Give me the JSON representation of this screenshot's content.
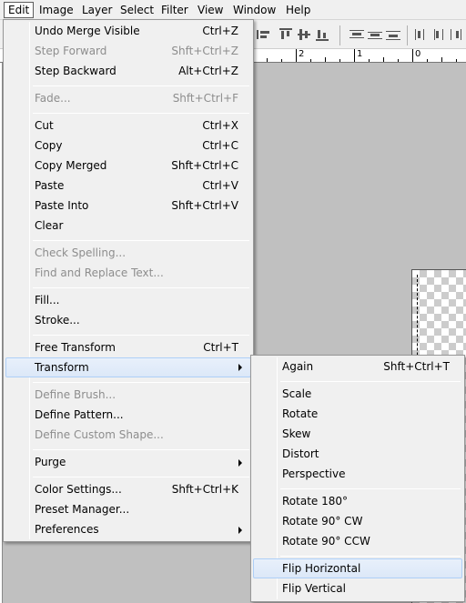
{
  "menubar": {
    "items": [
      "Edit",
      "Image",
      "Layer",
      "Select",
      "Filter",
      "View",
      "Window",
      "Help"
    ],
    "active": "Edit"
  },
  "ruler": {
    "labels": [
      "2",
      "1",
      "0"
    ]
  },
  "edit_menu": {
    "items": [
      {
        "label": "Undo Merge Visible",
        "shortcut": "Ctrl+Z",
        "enabled": true
      },
      {
        "label": "Step Forward",
        "shortcut": "Shft+Ctrl+Z",
        "enabled": false
      },
      {
        "label": "Step Backward",
        "shortcut": "Alt+Ctrl+Z",
        "enabled": true
      },
      {
        "label": "Fade...",
        "shortcut": "Shft+Ctrl+F",
        "enabled": false
      },
      {
        "label": "Cut",
        "shortcut": "Ctrl+X",
        "enabled": true
      },
      {
        "label": "Copy",
        "shortcut": "Ctrl+C",
        "enabled": true
      },
      {
        "label": "Copy Merged",
        "shortcut": "Shft+Ctrl+C",
        "enabled": true
      },
      {
        "label": "Paste",
        "shortcut": "Ctrl+V",
        "enabled": true
      },
      {
        "label": "Paste Into",
        "shortcut": "Shft+Ctrl+V",
        "enabled": true
      },
      {
        "label": "Clear",
        "shortcut": "",
        "enabled": true
      },
      {
        "label": "Check Spelling...",
        "shortcut": "",
        "enabled": false
      },
      {
        "label": "Find and Replace Text...",
        "shortcut": "",
        "enabled": false
      },
      {
        "label": "Fill...",
        "shortcut": "",
        "enabled": true
      },
      {
        "label": "Stroke...",
        "shortcut": "",
        "enabled": true
      },
      {
        "label": "Free Transform",
        "shortcut": "Ctrl+T",
        "enabled": true
      },
      {
        "label": "Transform",
        "shortcut": "",
        "enabled": true,
        "submenu": true,
        "highlighted": true
      },
      {
        "label": "Define Brush...",
        "shortcut": "",
        "enabled": false
      },
      {
        "label": "Define Pattern...",
        "shortcut": "",
        "enabled": true
      },
      {
        "label": "Define Custom Shape...",
        "shortcut": "",
        "enabled": false
      },
      {
        "label": "Purge",
        "shortcut": "",
        "enabled": true,
        "submenu": true
      },
      {
        "label": "Color Settings...",
        "shortcut": "Shft+Ctrl+K",
        "enabled": true
      },
      {
        "label": "Preset Manager...",
        "shortcut": "",
        "enabled": true
      },
      {
        "label": "Preferences",
        "shortcut": "",
        "enabled": true,
        "submenu": true
      }
    ]
  },
  "transform_menu": {
    "items": [
      {
        "label": "Again",
        "shortcut": "Shft+Ctrl+T"
      },
      {
        "label": "Scale",
        "shortcut": ""
      },
      {
        "label": "Rotate",
        "shortcut": ""
      },
      {
        "label": "Skew",
        "shortcut": ""
      },
      {
        "label": "Distort",
        "shortcut": ""
      },
      {
        "label": "Perspective",
        "shortcut": ""
      },
      {
        "label": "Rotate 180°",
        "shortcut": ""
      },
      {
        "label": "Rotate 90° CW",
        "shortcut": ""
      },
      {
        "label": "Rotate 90° CCW",
        "shortcut": ""
      },
      {
        "label": "Flip Horizontal",
        "shortcut": "",
        "highlighted": true
      },
      {
        "label": "Flip Vertical",
        "shortcut": ""
      }
    ]
  }
}
